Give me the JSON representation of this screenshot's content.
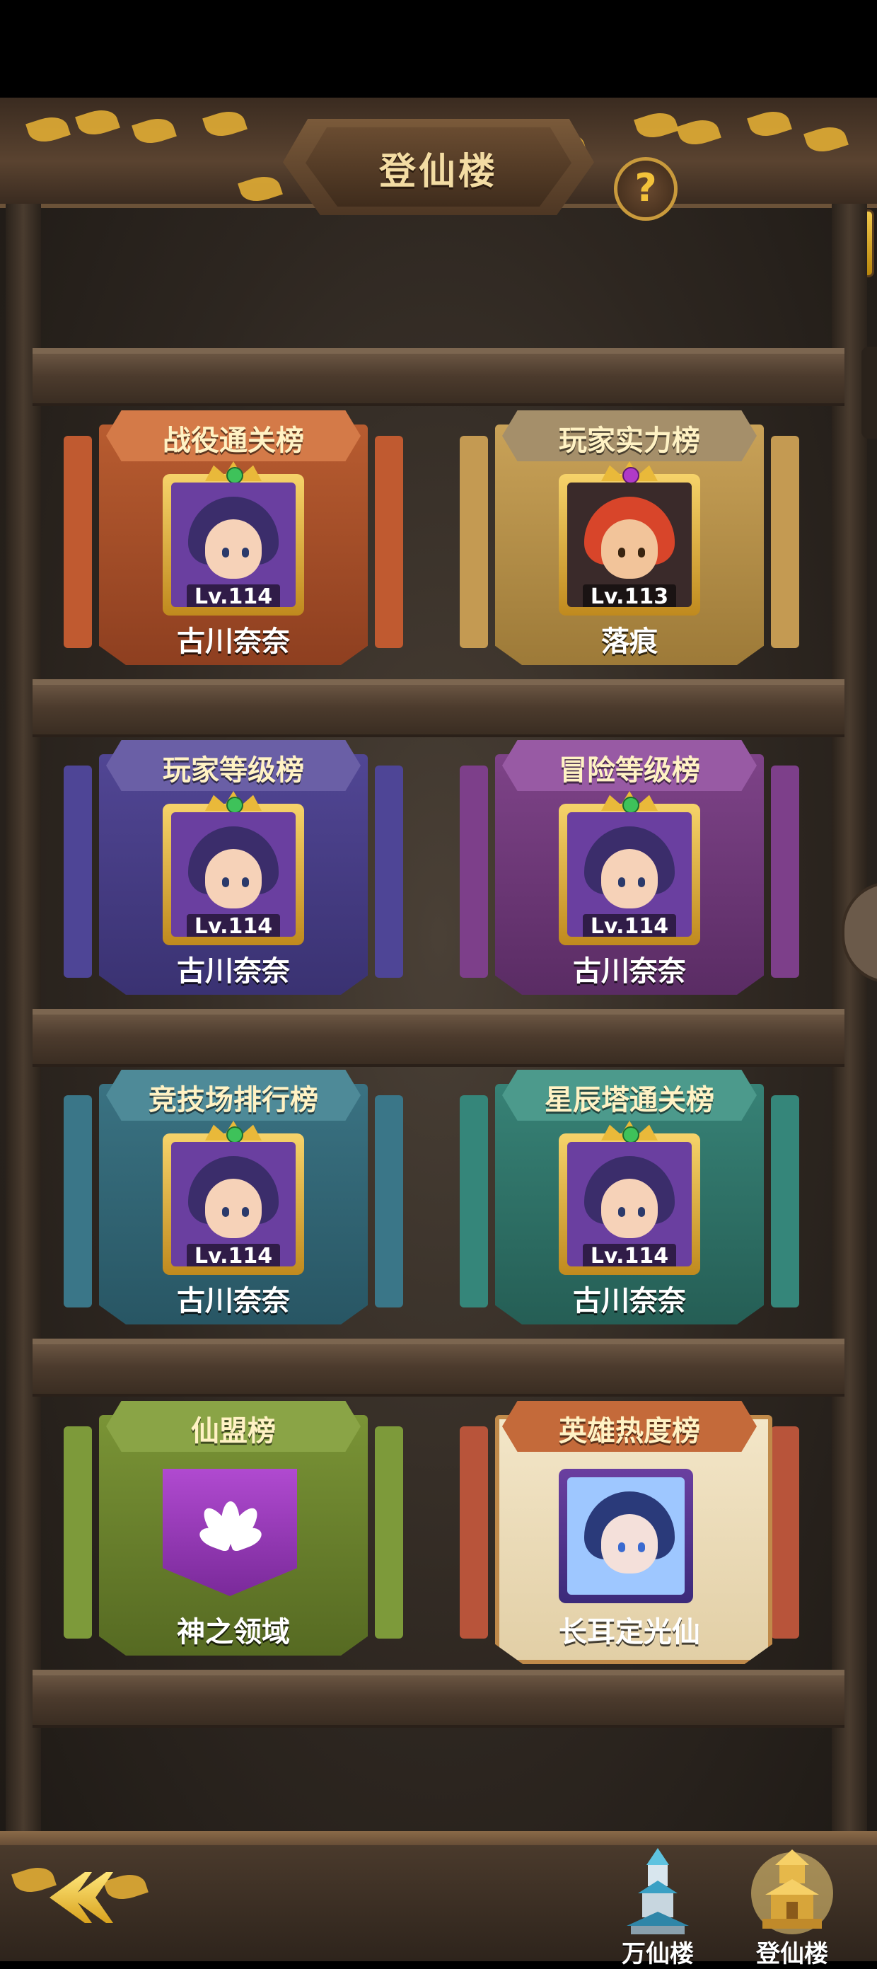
{
  "header": {
    "title": "登仙楼",
    "help_label": "?"
  },
  "panels": [
    {
      "title": "战役通关榜",
      "level": "Lv.114",
      "name": "古川奈奈"
    },
    {
      "title": "玩家实力榜",
      "level": "Lv.113",
      "name": "落痕"
    },
    {
      "title": "玩家等级榜",
      "level": "Lv.114",
      "name": "古川奈奈"
    },
    {
      "title": "冒险等级榜",
      "level": "Lv.114",
      "name": "古川奈奈"
    },
    {
      "title": "竞技场排行榜",
      "level": "Lv.114",
      "name": "古川奈奈"
    },
    {
      "title": "星辰塔通关榜",
      "level": "Lv.114",
      "name": "古川奈奈"
    },
    {
      "title": "仙盟榜",
      "name": "神之领域"
    },
    {
      "title": "英雄热度榜",
      "name": "长耳定光仙"
    }
  ],
  "nav": {
    "items": [
      {
        "label": "万仙楼"
      },
      {
        "label": "登仙楼"
      }
    ]
  },
  "colors": {
    "campaign": "#a24e2a",
    "power": "#b38a3e",
    "player_level": "#4a3f8a",
    "adventure": "#7a3f86",
    "arena": "#2f6a78",
    "star_tower": "#2f7a70",
    "guild": "#6f8a2f",
    "hero": "#efe1c2"
  },
  "icons": [
    "help-icon",
    "back-arrow-icon",
    "wanxian-tower-icon",
    "dengxian-tower-icon",
    "lotus-emblem-icon",
    "hero-portrait-icon"
  ]
}
